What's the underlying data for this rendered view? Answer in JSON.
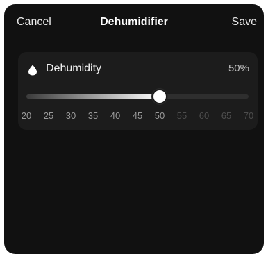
{
  "header": {
    "cancel_label": "Cancel",
    "title": "Dehumidifier",
    "save_label": "Save"
  },
  "dehumidity": {
    "icon": "water-drop-icon",
    "label": "Dehumidity",
    "value_text": "50%",
    "value": 50,
    "min": 20,
    "max": 70,
    "ticks": [
      "20",
      "25",
      "30",
      "35",
      "40",
      "45",
      "50",
      "55",
      "60",
      "65",
      "70"
    ]
  },
  "colors": {
    "background": "#111111",
    "card": "#1c1c1c",
    "track": "#2e2e2e",
    "thumb": "#ffffff"
  }
}
